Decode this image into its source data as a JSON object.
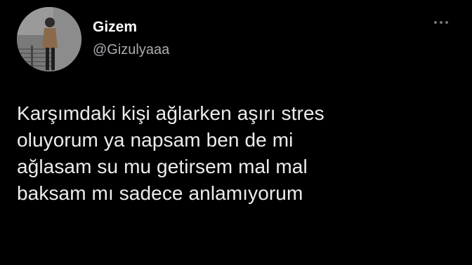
{
  "author": {
    "display_name": "Gizem",
    "handle": "@Gizulyaaa",
    "avatar_icon": "profile-photo"
  },
  "menu": {
    "more_icon": "more-options-icon"
  },
  "tweet": {
    "lines": [
      "Karşımdaki kişi ağlarken aşırı stres",
      "oluyorum ya napsam ben de mi",
      "ağlasam su mu getirsem mal mal",
      "baksam mı sadece anlamıyorum"
    ]
  },
  "colors": {
    "background": "#000000",
    "name": "#ffffff",
    "handle": "#a9acb0",
    "text": "#ececec"
  }
}
